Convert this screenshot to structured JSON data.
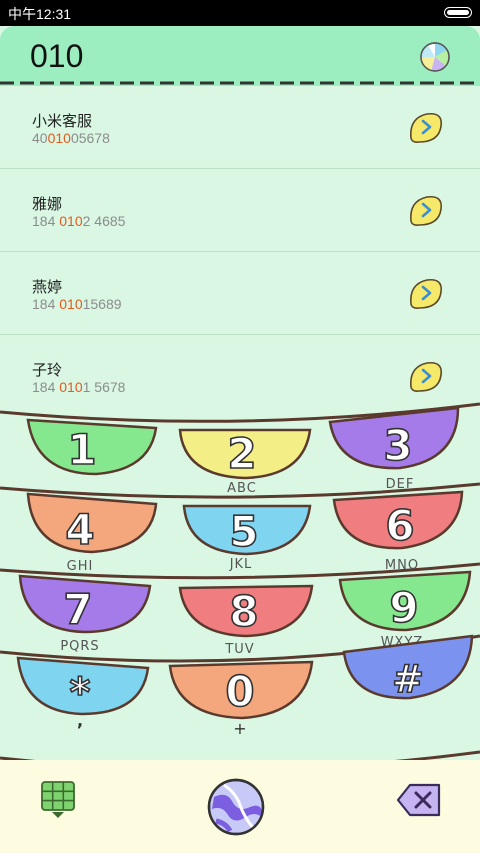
{
  "status": {
    "time": "中午12:31"
  },
  "dialer": {
    "number": "010"
  },
  "contacts": [
    {
      "name": "小米客服",
      "pre": "40",
      "hl": "010",
      "post": "05678"
    },
    {
      "name": "雅娜",
      "pre": "184 ",
      "hl": "010",
      "post": "2 4685"
    },
    {
      "name": "燕婷",
      "pre": "184 ",
      "hl": "010",
      "post": "15689"
    },
    {
      "name": "子玲",
      "pre": "184 ",
      "hl": "010",
      "post": "1 5678"
    }
  ],
  "keys": [
    {
      "digit": "1",
      "letters": ""
    },
    {
      "digit": "2",
      "letters": "ABC"
    },
    {
      "digit": "3",
      "letters": "DEF"
    },
    {
      "digit": "4",
      "letters": "GHI"
    },
    {
      "digit": "5",
      "letters": "JKL"
    },
    {
      "digit": "6",
      "letters": "MNO"
    },
    {
      "digit": "7",
      "letters": "PQRS"
    },
    {
      "digit": "8",
      "letters": "TUV"
    },
    {
      "digit": "9",
      "letters": "WXYZ"
    },
    {
      "digit": "*",
      "letters": ","
    },
    {
      "digit": "0",
      "letters": "+"
    },
    {
      "digit": "#",
      "letters": ""
    }
  ],
  "colors": {
    "key_green": "#86e88e",
    "key_yellow": "#f4ee86",
    "key_purple": "#a57bea",
    "key_orange": "#f4a77d",
    "key_blue": "#7fd4f0",
    "key_red": "#f07d80",
    "highlight": "#e45b1e",
    "header": "#9ceec0",
    "background": "#d9f7e3",
    "bottom": "#fdfce0"
  },
  "icons": {
    "dialpad": "dialpad-grid-icon",
    "call": "call-marble-icon",
    "delete": "backspace-icon",
    "candy": "candy-icon",
    "detail": "lemon-arrow-icon"
  }
}
